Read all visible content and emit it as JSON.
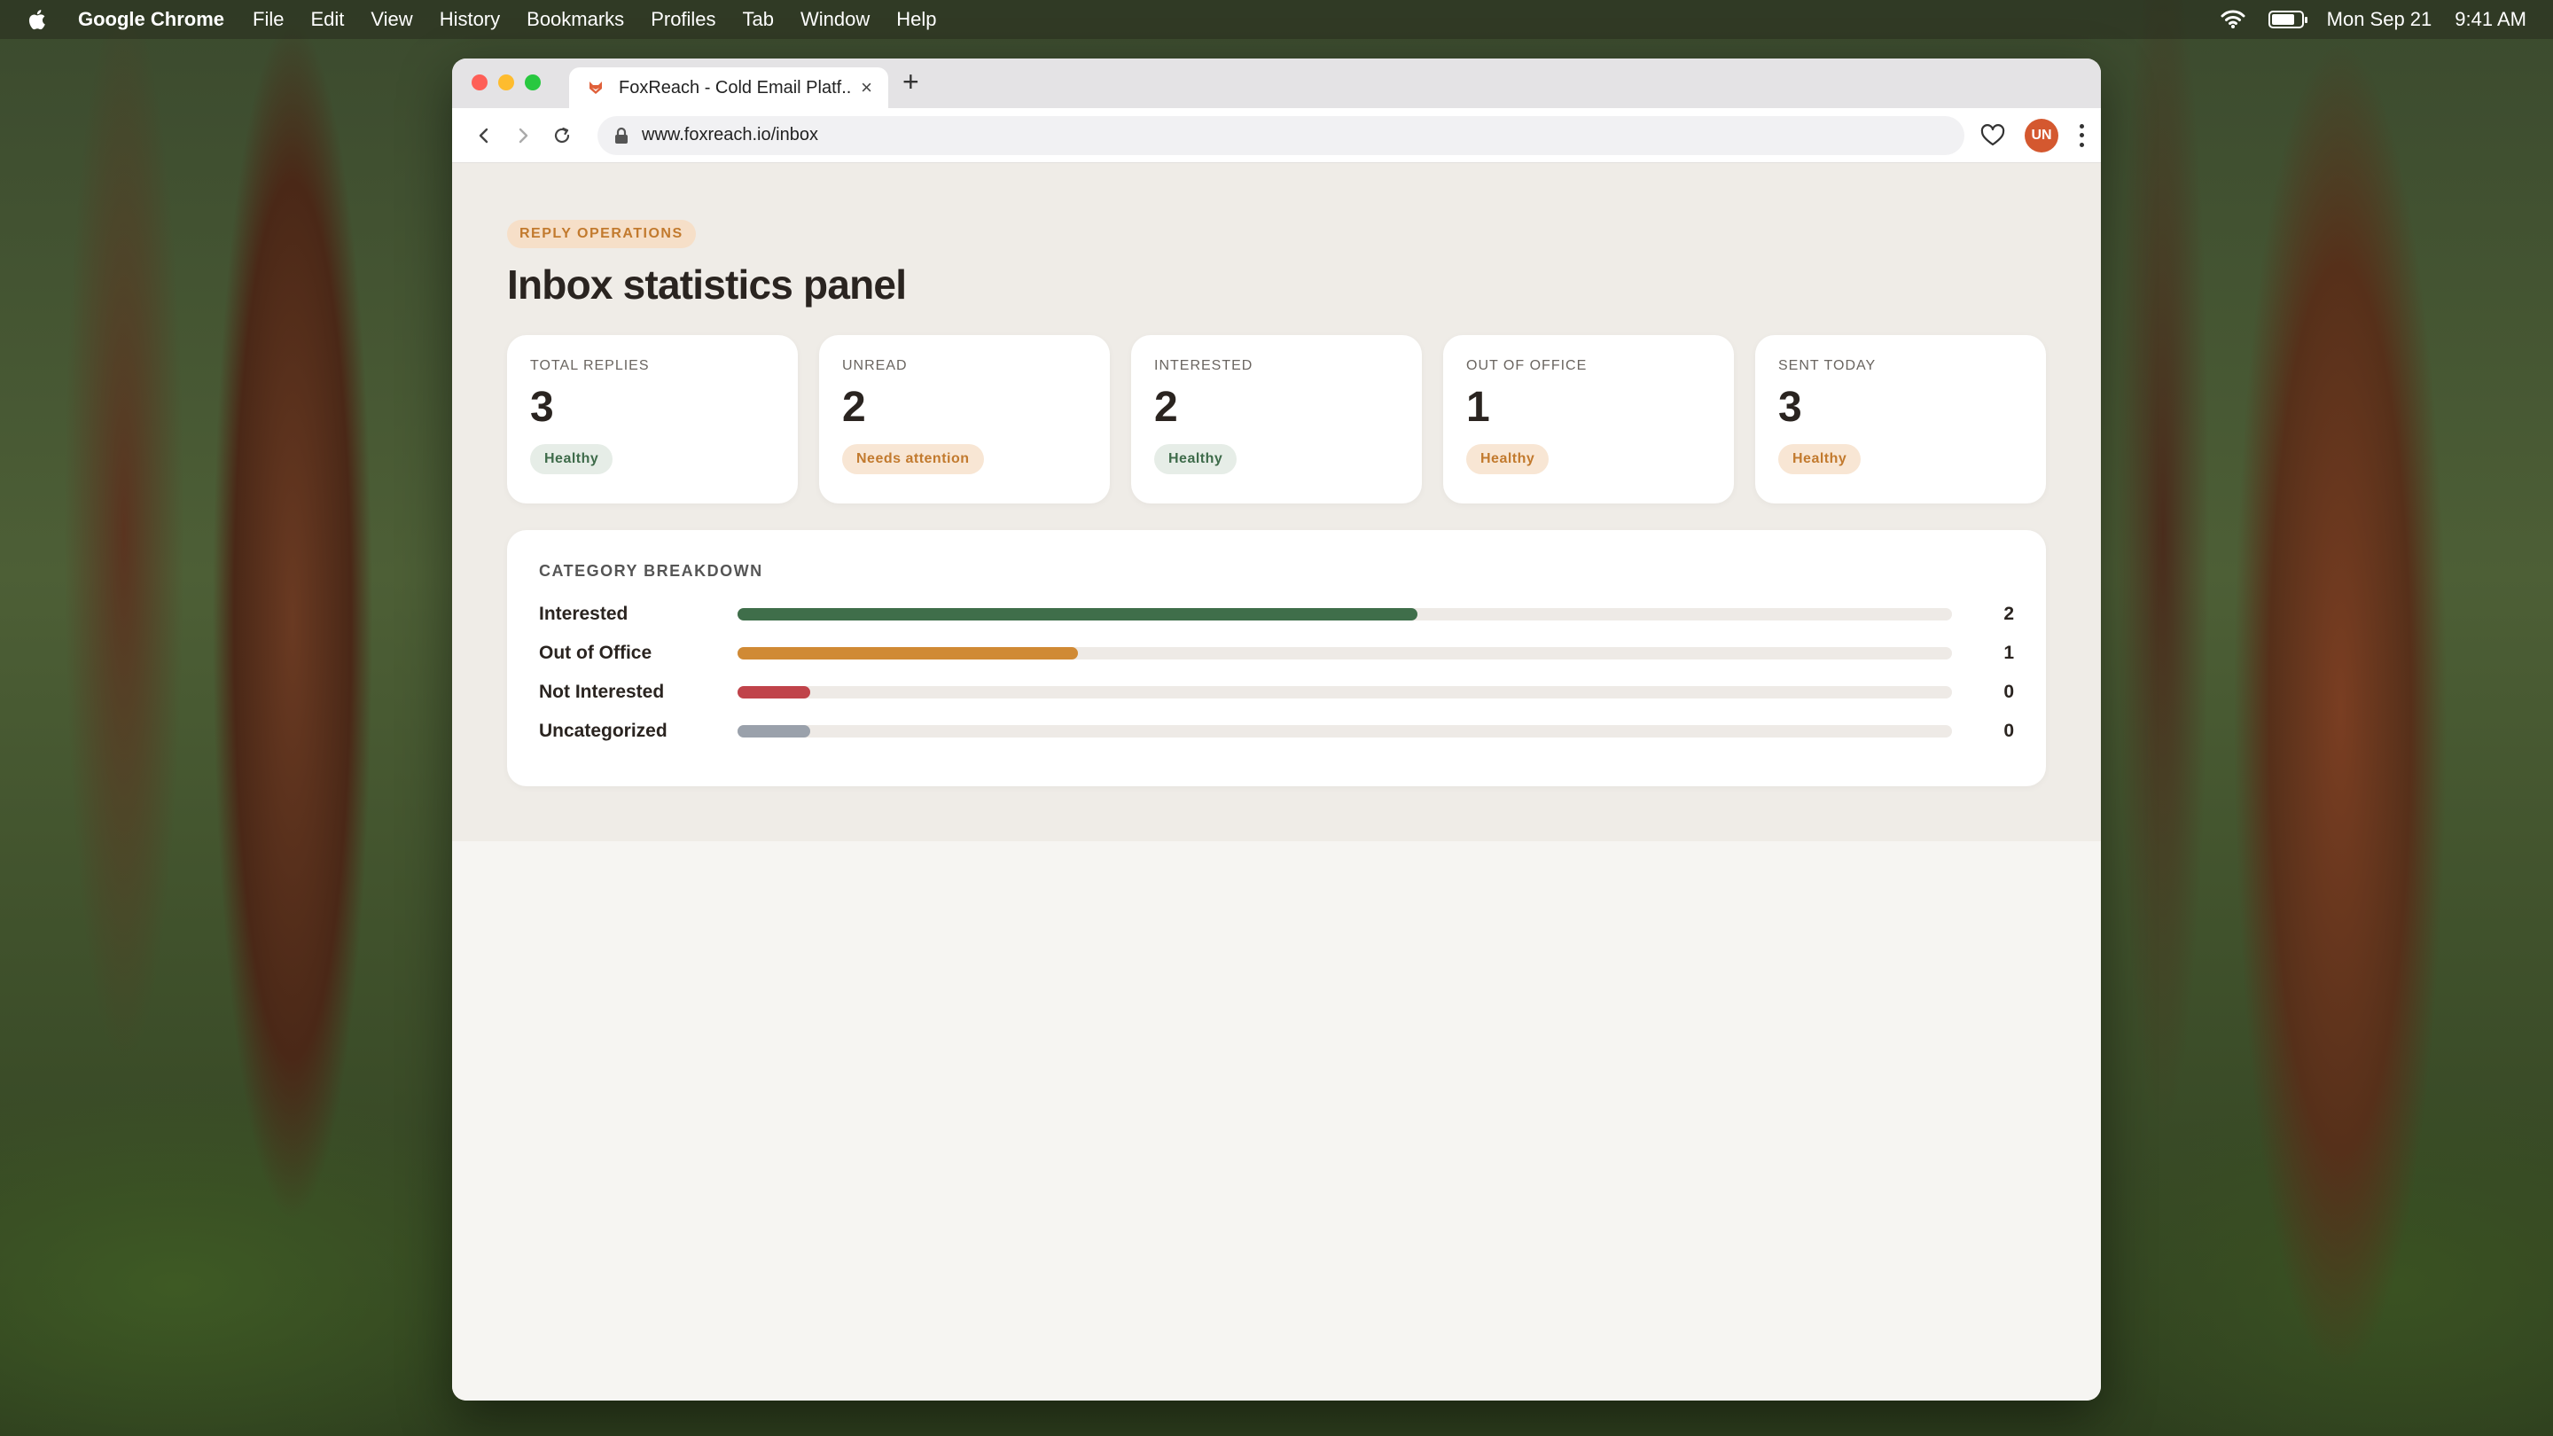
{
  "menubar": {
    "app": "Google Chrome",
    "items": [
      "File",
      "Edit",
      "View",
      "History",
      "Bookmarks",
      "Profiles",
      "Tab",
      "Window",
      "Help"
    ],
    "date": "Mon Sep 21",
    "time": "9:41 AM"
  },
  "browser": {
    "tab_title": "FoxReach - Cold Email Platf...",
    "url": "www.foxreach.io/inbox",
    "avatar_initials": "UN"
  },
  "page": {
    "eyebrow": "REPLY OPERATIONS",
    "title": "Inbox statistics panel",
    "stats": [
      {
        "label": "TOTAL REPLIES",
        "value": "3",
        "badge": "Healthy",
        "tone": "green"
      },
      {
        "label": "UNREAD",
        "value": "2",
        "badge": "Needs attention",
        "tone": "orange"
      },
      {
        "label": "INTERESTED",
        "value": "2",
        "badge": "Healthy",
        "tone": "green"
      },
      {
        "label": "OUT OF OFFICE",
        "value": "1",
        "badge": "Healthy",
        "tone": "orange"
      },
      {
        "label": "SENT TODAY",
        "value": "3",
        "badge": "Healthy",
        "tone": "orange"
      }
    ],
    "breakdown": {
      "title": "CATEGORY BREAKDOWN",
      "rows": [
        {
          "label": "Interested",
          "count": "2",
          "fill": 0.56,
          "color": "#3f6e4a"
        },
        {
          "label": "Out of Office",
          "count": "1",
          "fill": 0.28,
          "color": "#d08a35"
        },
        {
          "label": "Not Interested",
          "count": "0",
          "fill": 0.06,
          "color": "#c0434a"
        },
        {
          "label": "Uncategorized",
          "count": "0",
          "fill": 0.06,
          "color": "#9aa1ab"
        }
      ]
    }
  }
}
